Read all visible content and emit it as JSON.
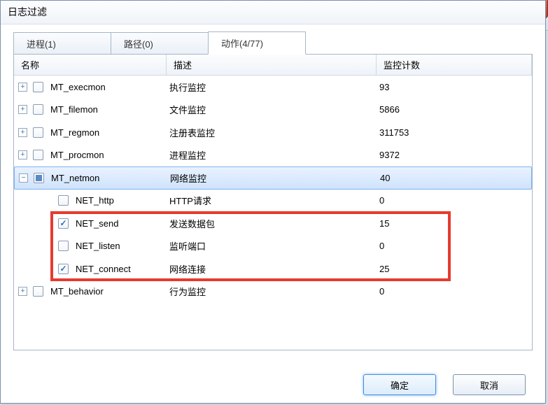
{
  "dialog_title": "日志过滤",
  "tabs": [
    {
      "label": "进程(1)"
    },
    {
      "label": "路径(0)"
    },
    {
      "label": "动作(4/77)"
    }
  ],
  "columns": {
    "name": "名称",
    "desc": "描述",
    "count": "监控计数"
  },
  "rows": [
    {
      "indent": 0,
      "exp": "+",
      "chk": "off",
      "name": "MT_execmon",
      "desc": "执行监控",
      "count": "93",
      "sel": false
    },
    {
      "indent": 0,
      "exp": "+",
      "chk": "off",
      "name": "MT_filemon",
      "desc": "文件监控",
      "count": "5866",
      "sel": false
    },
    {
      "indent": 0,
      "exp": "+",
      "chk": "off",
      "name": "MT_regmon",
      "desc": "注册表监控",
      "count": "311753",
      "sel": false
    },
    {
      "indent": 0,
      "exp": "+",
      "chk": "off",
      "name": "MT_procmon",
      "desc": "进程监控",
      "count": "9372",
      "sel": false
    },
    {
      "indent": 0,
      "exp": "-",
      "chk": "mixed",
      "name": "MT_netmon",
      "desc": "网络监控",
      "count": "40",
      "sel": true
    },
    {
      "indent": 1,
      "exp": "",
      "chk": "off",
      "name": "NET_http",
      "desc": "HTTP请求",
      "count": "0",
      "sel": false
    },
    {
      "indent": 1,
      "exp": "",
      "chk": "on",
      "name": "NET_send",
      "desc": "发送数据包",
      "count": "15",
      "sel": false
    },
    {
      "indent": 1,
      "exp": "",
      "chk": "off",
      "name": "NET_listen",
      "desc": "监听端口",
      "count": "0",
      "sel": false
    },
    {
      "indent": 1,
      "exp": "",
      "chk": "on",
      "name": "NET_connect",
      "desc": "网络连接",
      "count": "25",
      "sel": false
    },
    {
      "indent": 0,
      "exp": "+",
      "chk": "off",
      "name": "MT_behavior",
      "desc": "行为监控",
      "count": "0",
      "sel": false
    }
  ],
  "buttons": {
    "ok": "确定",
    "cancel": "取消"
  }
}
